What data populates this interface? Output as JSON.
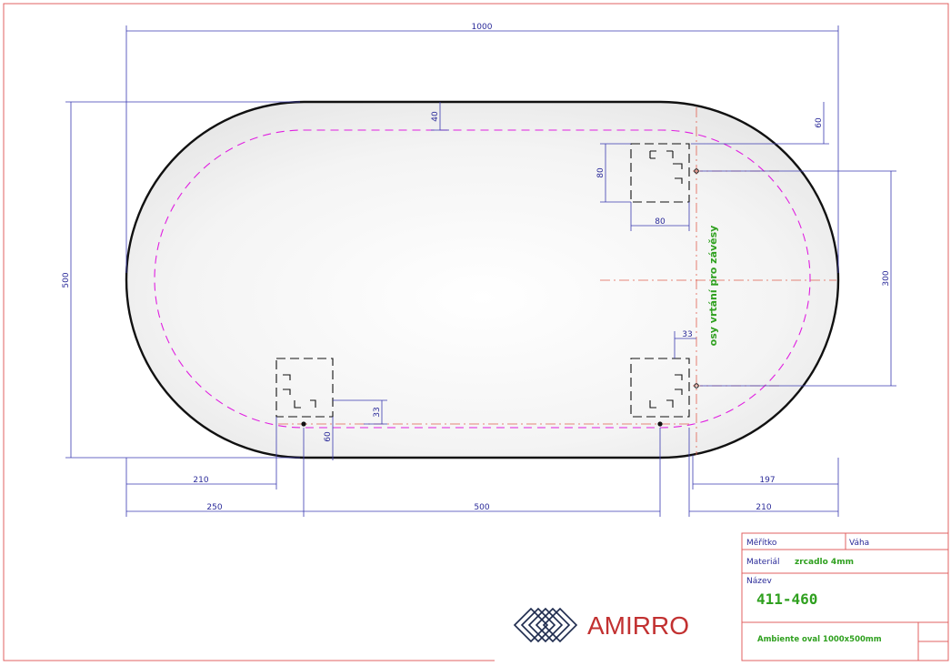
{
  "drawing": {
    "dimensions": {
      "overall_width": "1000",
      "overall_height": "500",
      "edge_offset_top": "40",
      "hook_offset_top": "60",
      "plate_height": "80",
      "plate_width": "80",
      "hook_spacing_vertical": "300",
      "plate_offset": "33",
      "hook_offset_bottom_33": "33",
      "hook_offset_bottom_60": "60",
      "left_offset_210": "210",
      "left_offset_250": "250",
      "hook_spacing_horizontal": "500",
      "right_offset_197": "197",
      "right_offset_210": "210"
    },
    "axis_note": "osy vrtání pro závěsy"
  },
  "title_block": {
    "scale_label": "Měřítko",
    "weight_label": "Váha",
    "material_label": "Materiál",
    "material_value": "zrcadlo 4mm",
    "name_label": "Název",
    "code": "411-460",
    "description": "Ambiente oval 1000x500mm"
  },
  "logo": {
    "brand": "AMIRRO"
  },
  "colors": {
    "dimension": "#2a2a99",
    "hidden_line": "#e020e0",
    "axis_line": "#e06050",
    "frame": "#e06060",
    "note": "#2fa01f",
    "logo_text": "#c23131",
    "logo_mark": "#1d2a4d"
  }
}
